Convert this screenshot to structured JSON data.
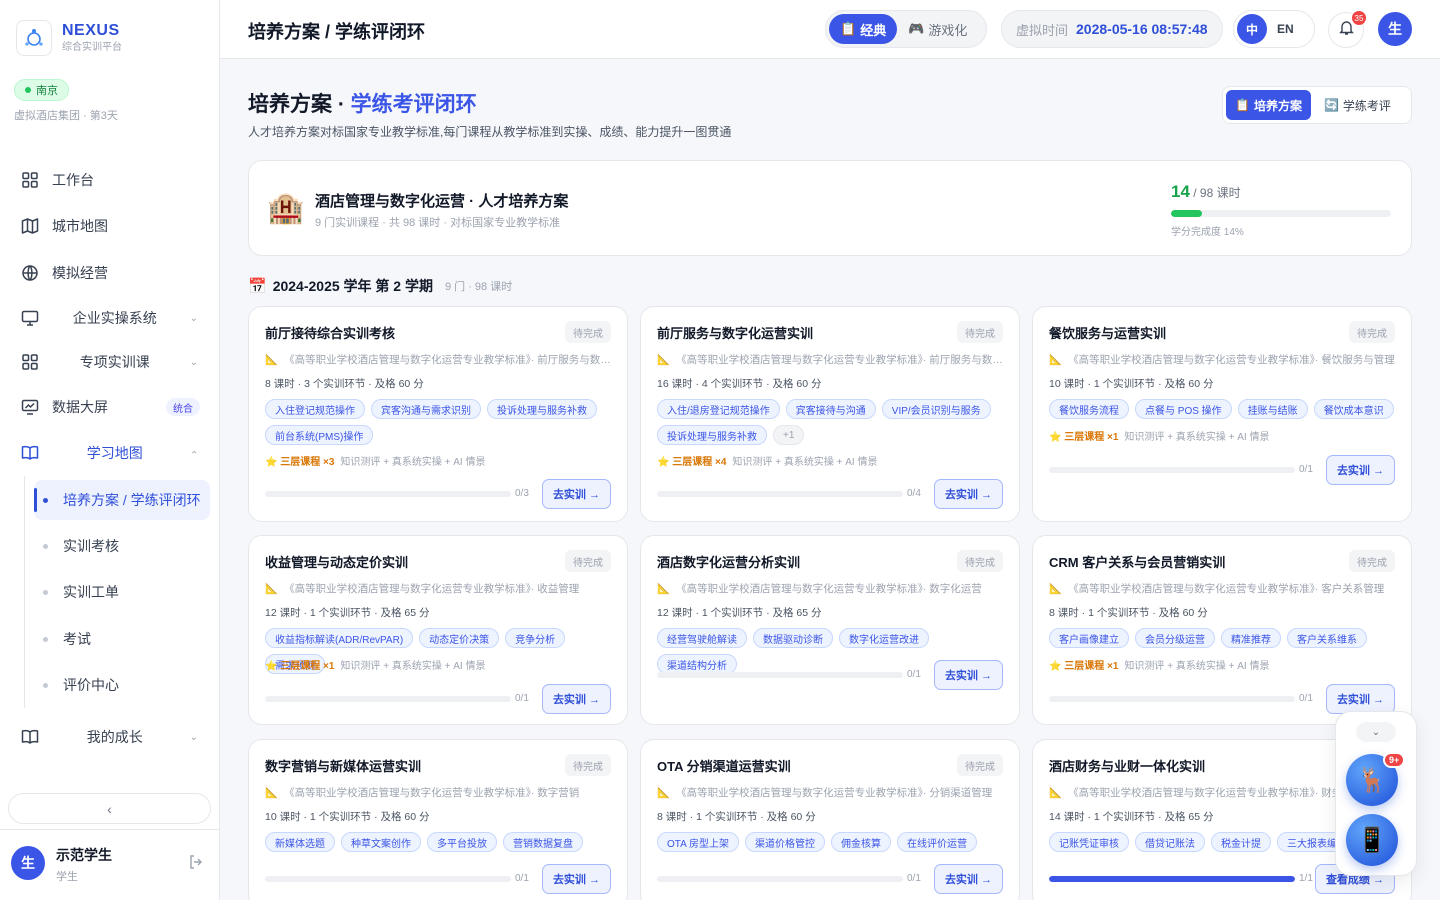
{
  "brand": {
    "name": "NEXUS",
    "subtitle": "综合实训平台"
  },
  "city": {
    "name": "南京",
    "sub": "虚拟酒店集团 · 第3天"
  },
  "nav": [
    {
      "label": "工作台",
      "icon": "grid-icon"
    },
    {
      "label": "城市地图",
      "icon": "map-icon"
    },
    {
      "label": "模拟经营",
      "icon": "globe-icon"
    },
    {
      "label": "企业实操系统",
      "icon": "monitor-icon"
    },
    {
      "label": "专项实训课",
      "icon": "grid-icon"
    },
    {
      "label": "数据大屏",
      "icon": "chart-screen-icon",
      "tag": "统合"
    },
    {
      "label": "学习地图",
      "icon": "book-icon"
    },
    {
      "label": "我的成长",
      "icon": "book-icon"
    }
  ],
  "subnav": [
    "培养方案 / 学练评闭环",
    "实训考核",
    "实训工单",
    "考试",
    "评价中心"
  ],
  "user": {
    "name": "示范学生",
    "role": "学生",
    "avatar": "生"
  },
  "header": {
    "title": "培养方案 / 学练评闭环",
    "mode_classic": "经典",
    "mode_game": "游戏化",
    "vtime_label": "虚拟时间",
    "vtime_value": "2028-05-16 08:57:48",
    "lang_zh": "中",
    "lang_en": "EN",
    "notif_count": "35",
    "avatar": "生"
  },
  "page": {
    "title_a": "培养方案 · ",
    "title_b": "学练考评闭环",
    "subtitle": "人才培养方案对标国家专业教学标准,每门课程从教学标准到实操、成绩、能力提升一图贯通",
    "view_plan": "培养方案",
    "view_eval": "学练考评"
  },
  "plan": {
    "title": "酒店管理与数字化运营 · 人才培养方案",
    "sub": "9 门实训课程 · 共 98 课时 · 对标国家专业教学标准",
    "done": "14",
    "total": " / 98 课时",
    "progress": 0.14,
    "pct_label": "学分完成度 14%"
  },
  "term": {
    "title": "2024-2025 学年 第 2 学期",
    "meta": "9 门 · 98 课时"
  },
  "courses": [
    {
      "title": "前厅接待综合实训考核",
      "status": "待完成",
      "std": "《高等职业学校酒店管理与数字化运营专业教学标准》· 前厅服务与数字化运营",
      "meta": "8 课时 · 3 个实训环节 · 及格 60 分",
      "tags": [
        "入住登记规范操作",
        "宾客沟通与需求识别",
        "投诉处理与服务补救",
        "前台系统(PMS)操作"
      ],
      "more": "",
      "tier": "⭐ 三层课程 ×3",
      "tier_desc": "知识测评 + 真系统实操 + AI 情景",
      "progress": 0,
      "count": "0/3",
      "btn": "去实训 →"
    },
    {
      "title": "前厅服务与数字化运营实训",
      "status": "待完成",
      "std": "《高等职业学校酒店管理与数字化运营专业教学标准》· 前厅服务与数字化运营",
      "meta": "16 课时 · 4 个实训环节 · 及格 60 分",
      "tags": [
        "入住/退房登记规范操作",
        "宾客接待与沟通",
        "VIP/会员识别与服务",
        "投诉处理与服务补救"
      ],
      "more": "+1",
      "tier": "⭐ 三层课程 ×4",
      "tier_desc": "知识测评 + 真系统实操 + AI 情景",
      "progress": 0,
      "count": "0/4",
      "btn": "去实训 →"
    },
    {
      "title": "餐饮服务与运营实训",
      "status": "待完成",
      "std": "《高等职业学校酒店管理与数字化运营专业教学标准》· 餐饮服务与管理",
      "meta": "10 课时 · 1 个实训环节 · 及格 60 分",
      "tags": [
        "餐饮服务流程",
        "点餐与 POS 操作",
        "挂账与结账",
        "餐饮成本意识"
      ],
      "more": "",
      "tier": "⭐ 三层课程 ×1",
      "tier_desc": "知识测评 + 真系统实操 + AI 情景",
      "progress": 0,
      "count": "0/1",
      "btn": "去实训 →"
    },
    {
      "title": "收益管理与动态定价实训",
      "status": "待完成",
      "std": "《高等职业学校酒店管理与数字化运营专业教学标准》· 收益管理",
      "meta": "12 课时 · 1 个实训环节 · 及格 65 分",
      "tags": [
        "收益指标解读(ADR/RevPAR)",
        "动态定价决策",
        "竞争分析",
        "需求预测"
      ],
      "more": "",
      "tier": "⭐ 三层课程 ×1",
      "tier_desc": "知识测评 + 真系统实操 + AI 情景",
      "progress": 0,
      "count": "0/1",
      "btn": "去实训 →"
    },
    {
      "title": "酒店数字化运营分析实训",
      "status": "待完成",
      "std": "《高等职业学校酒店管理与数字化运营专业教学标准》· 数字化运营",
      "meta": "12 课时 · 1 个实训环节 · 及格 65 分",
      "tags": [
        "经营驾驶舱解读",
        "数据驱动诊断",
        "数字化运营改进",
        "渠道结构分析"
      ],
      "more": "",
      "tier": "",
      "tier_desc": "",
      "progress": 0,
      "count": "0/1",
      "btn": "去实训 →"
    },
    {
      "title": "CRM 客户关系与会员营销实训",
      "status": "待完成",
      "std": "《高等职业学校酒店管理与数字化运营专业教学标准》· 客户关系管理",
      "meta": "8 课时 · 1 个实训环节 · 及格 60 分",
      "tags": [
        "客户画像建立",
        "会员分级运营",
        "精准推荐",
        "客户关系维系"
      ],
      "more": "",
      "tier": "⭐ 三层课程 ×1",
      "tier_desc": "知识测评 + 真系统实操 + AI 情景",
      "progress": 0,
      "count": "0/1",
      "btn": "去实训 →"
    },
    {
      "title": "数字营销与新媒体运营实训",
      "status": "待完成",
      "std": "《高等职业学校酒店管理与数字化运营专业教学标准》· 数字营销",
      "meta": "10 课时 · 1 个实训环节 · 及格 60 分",
      "tags": [
        "新媒体选题",
        "种草文案创作",
        "多平台投放",
        "营销数据复盘"
      ],
      "more": "",
      "tier": "",
      "tier_desc": "",
      "progress": 0,
      "count": "0/1",
      "btn": "去实训 →"
    },
    {
      "title": "OTA 分销渠道运营实训",
      "status": "待完成",
      "std": "《高等职业学校酒店管理与数字化运营专业教学标准》· 分销渠道管理",
      "meta": "8 课时 · 1 个实训环节 · 及格 60 分",
      "tags": [
        "OTA 房型上架",
        "渠道价格管控",
        "佣金核算",
        "在线评价运营"
      ],
      "more": "",
      "tier": "",
      "tier_desc": "",
      "progress": 0,
      "count": "0/1",
      "btn": "去实训 →"
    },
    {
      "title": "酒店财务与业财一体化实训",
      "status": "",
      "std": "《高等职业学校酒店管理与数字化运营专业教学标准》· 财务管",
      "meta": "14 课时 · 1 个实训环节 · 及格 65 分",
      "tags": [
        "记账凭证审核",
        "借贷记账法",
        "税金计提",
        "三大报表编制"
      ],
      "more": "",
      "tier": "",
      "tier_desc": "",
      "progress": 1,
      "count": "1/1",
      "btn": "查看成绩 →"
    }
  ],
  "float": {
    "badge": "9+",
    "mascot_icon": "deer-icon",
    "phone_icon": "phone-icon"
  },
  "colors": {
    "accent": "#3b55e6",
    "success": "#22c55e"
  }
}
